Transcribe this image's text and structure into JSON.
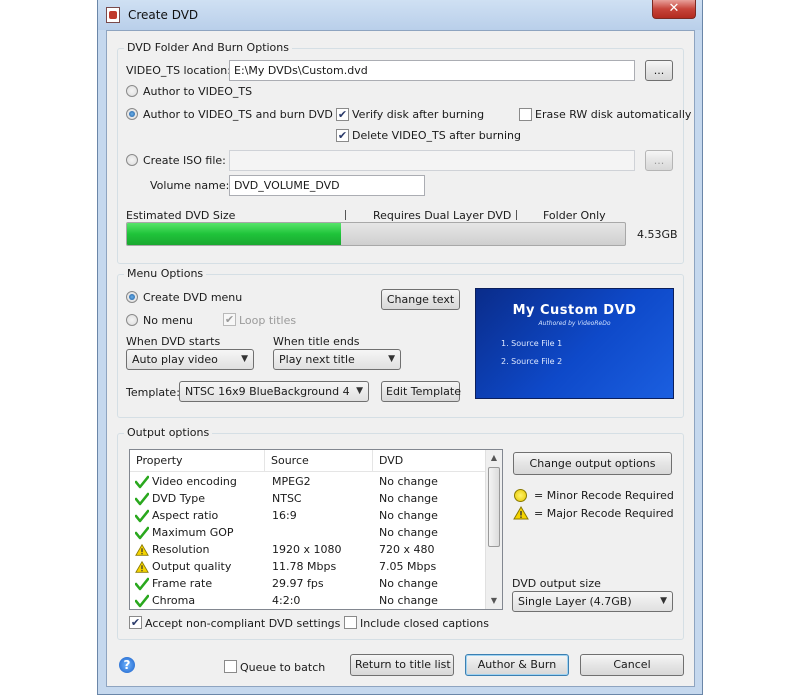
{
  "window": {
    "title": "Create DVD",
    "close_glyph": "✕"
  },
  "dvd_folder": {
    "group_label": "DVD Folder And Burn Options",
    "video_ts_label": "VIDEO_TS location:",
    "video_ts_value": "E:\\My DVDs\\Custom.dvd",
    "browse_label": "...",
    "author_only_label": "Author to VIDEO_TS",
    "author_burn_label": "Author to VIDEO_TS and burn DVD",
    "verify_label": "Verify disk after burning",
    "erase_label": "Erase RW disk automatically",
    "delete_label": "Delete VIDEO_TS after burning",
    "iso_label": "Create ISO file:",
    "iso_value": "",
    "iso_browse_label": "...",
    "volume_label": "Volume name:",
    "volume_value": "DVD_VOLUME_DVD",
    "selected_mode": "author_burn",
    "verify_checked": true,
    "erase_checked": false,
    "delete_checked": true
  },
  "size_bar": {
    "estimated_label": "Estimated DVD Size",
    "dual_layer_label": "Requires Dual Layer DVD",
    "folder_only_label": "Folder Only",
    "size_text": "4.53GB",
    "fill_fraction": 0.43,
    "fill_color": "#1fc33a"
  },
  "menu": {
    "group_label": "Menu Options",
    "create_label": "Create DVD menu",
    "no_menu_label": "No menu",
    "loop_label": "Loop titles",
    "change_text_label": "Change text",
    "when_starts_label": "When DVD starts",
    "when_starts_value": "Auto play video",
    "when_ends_label": "When title ends",
    "when_ends_value": "Play next title",
    "template_label": "Template:",
    "template_value": "NTSC 16x9 BlueBackground 4",
    "edit_template_label": "Edit Template",
    "preview": {
      "title": "My Custom DVD",
      "subtitle": "Authored by VideoReDo",
      "items": [
        "1. Source File 1",
        "2. Source File 2"
      ]
    }
  },
  "output": {
    "group_label": "Output options",
    "columns": [
      "Property",
      "Source",
      "DVD"
    ],
    "rows": [
      {
        "status": "ok",
        "property": "Video encoding",
        "source": "MPEG2",
        "dvd": "No change"
      },
      {
        "status": "ok",
        "property": "DVD Type",
        "source": "NTSC",
        "dvd": "No change"
      },
      {
        "status": "ok",
        "property": "Aspect ratio",
        "source": "16:9",
        "dvd": "No change"
      },
      {
        "status": "ok",
        "property": "Maximum GOP",
        "source": "",
        "dvd": "No change"
      },
      {
        "status": "major",
        "property": "Resolution",
        "source": "1920 x 1080",
        "dvd": "720 x 480"
      },
      {
        "status": "major",
        "property": "Output quality",
        "source": "11.78 Mbps",
        "dvd": "7.05 Mbps"
      },
      {
        "status": "ok",
        "property": "Frame rate",
        "source": "29.97 fps",
        "dvd": "No change"
      },
      {
        "status": "ok",
        "property": "Chroma",
        "source": "4:2:0",
        "dvd": "No change"
      }
    ],
    "change_output_label": "Change output options",
    "minor_label": "= Minor Recode Required",
    "major_label": "= Major Recode Required",
    "size_label": "DVD output size",
    "size_value": "Single Layer (4.7GB)",
    "accept_label": "Accept non-compliant DVD settings",
    "captions_label": "Include closed captions",
    "accept_checked": true,
    "captions_checked": false
  },
  "footer": {
    "help_glyph": "?",
    "queue_label": "Queue to batch",
    "return_label": "Return to title list",
    "author_burn_label": "Author & Burn",
    "cancel_label": "Cancel"
  },
  "icons": {
    "ok": "green-checkmark-icon",
    "minor": "yellow-circle-icon",
    "major": "yellow-warning-triangle-icon",
    "dropdown": "chevron-down-icon"
  },
  "colors": {
    "ok": "#2aa81e",
    "warning": "#f5d400",
    "accent_green": "#1fc33a",
    "preview_blue": "#0e49c9"
  }
}
